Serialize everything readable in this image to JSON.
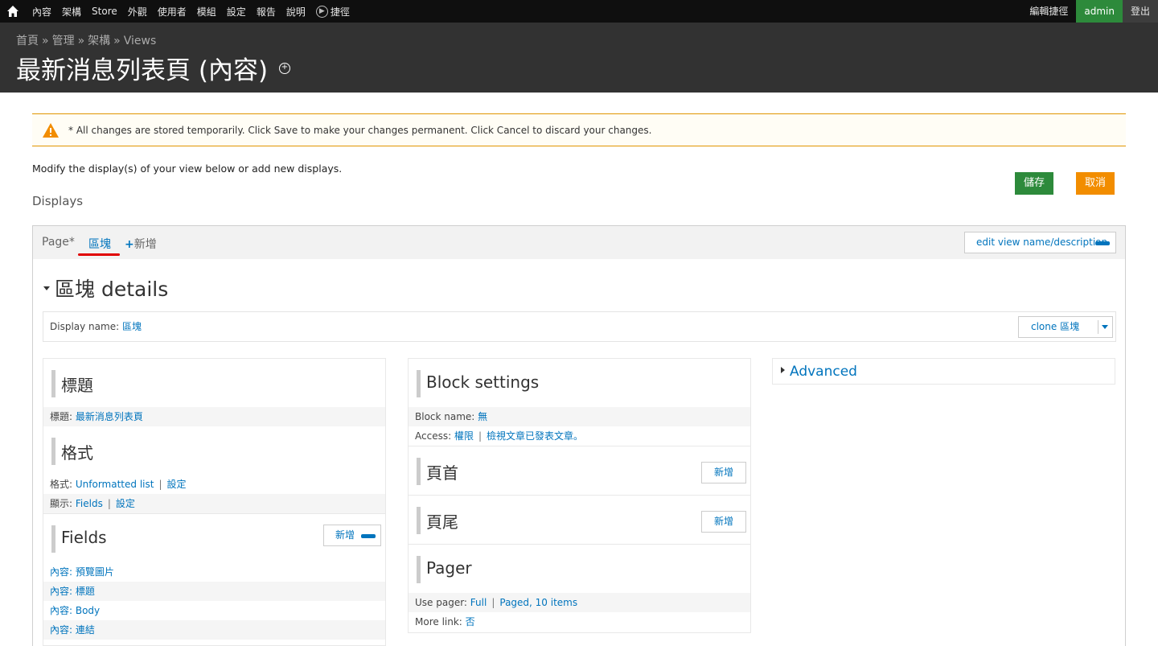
{
  "toolbar": {
    "menu": [
      "內容",
      "架構",
      "Store",
      "外觀",
      "使用者",
      "模組",
      "設定",
      "報告",
      "說明"
    ],
    "shortcuts": "捷徑",
    "edit_shortcuts": "編輯捷徑",
    "user": "admin",
    "logout": "登出"
  },
  "breadcrumb": [
    "首頁",
    "管理",
    "架構",
    "Views"
  ],
  "breadcrumb_sep": "»",
  "page_title": "最新消息列表頁 (內容)",
  "warning": {
    "message": "* All changes are stored temporarily. Click Save to make your changes permanent. Click Cancel to discard your changes."
  },
  "intro": "Modify the display(s) of your view below or add new displays.",
  "displays_label": "Displays",
  "buttons": {
    "save": "儲存",
    "cancel": "取消"
  },
  "tabs": {
    "page": "Page*",
    "block": "區塊",
    "add": "新增",
    "edit_view": "edit view name/description"
  },
  "details": {
    "title": "區塊 details",
    "display_name_label": "Display name:",
    "display_name_value": "區塊",
    "clone_label": "clone 區塊"
  },
  "col1": {
    "title_section": "標題",
    "title_label": "標題:",
    "title_value": "最新消息列表頁",
    "format_section": "格式",
    "format_label": "格式:",
    "format_value": "Unformatted list",
    "format_settings": "設定",
    "show_label": "顯示:",
    "show_value": "Fields",
    "show_settings": "設定",
    "fields_section": "Fields",
    "fields_add": "新增",
    "fields": [
      "內容: 預覽圖片",
      "內容: 標題",
      "內容: Body",
      "內容: 連結"
    ]
  },
  "col2": {
    "block_settings": "Block settings",
    "block_name_label": "Block name:",
    "block_name_value": "無",
    "access_label": "Access:",
    "access_value": "權限",
    "access_detail": "檢視文章已發表文章。",
    "header_section": "頁首",
    "header_add": "新增",
    "footer_section": "頁尾",
    "footer_add": "新增",
    "pager_section": "Pager",
    "use_pager_label": "Use pager:",
    "use_pager_value": "Full",
    "use_pager_detail": "Paged, 10 items",
    "more_link_label": "More link:",
    "more_link_value": "否"
  },
  "col3": {
    "advanced": "Advanced"
  },
  "sep": "|"
}
